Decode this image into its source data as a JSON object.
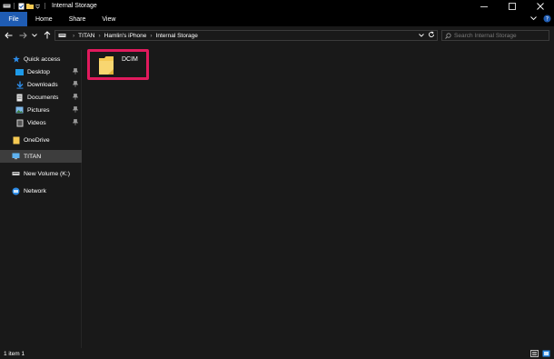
{
  "window": {
    "title": "Internal Storage",
    "controls": [
      "minimize-icon",
      "maximize-icon",
      "close-icon"
    ]
  },
  "ribbon": {
    "tabs": [
      {
        "label": "File",
        "active": true
      },
      {
        "label": "Home"
      },
      {
        "label": "Share"
      },
      {
        "label": "View"
      }
    ]
  },
  "address": {
    "breadcrumbs": [
      "TITAN",
      "Hamlin's iPhone",
      "Internal Storage"
    ],
    "search_placeholder": "Search Internal Storage"
  },
  "nav": {
    "quick_access": "Quick access",
    "items": [
      {
        "label": "Desktop",
        "pinned": true
      },
      {
        "label": "Downloads",
        "pinned": true
      },
      {
        "label": "Documents",
        "pinned": true
      },
      {
        "label": "Pictures",
        "pinned": true
      },
      {
        "label": "Videos",
        "pinned": true
      }
    ],
    "onedrive": "OneDrive",
    "this_pc": "TITAN",
    "volume": "New Volume (K:)",
    "network": "Network"
  },
  "content": {
    "items": [
      {
        "name": "DCIM",
        "type": "folder",
        "highlighted": true
      }
    ]
  },
  "status": {
    "text": "1 item   1"
  },
  "colors": {
    "accent": "#1f5cb3",
    "highlight": "#e11a5d",
    "background": "#191919",
    "folder": "#f5c952"
  }
}
